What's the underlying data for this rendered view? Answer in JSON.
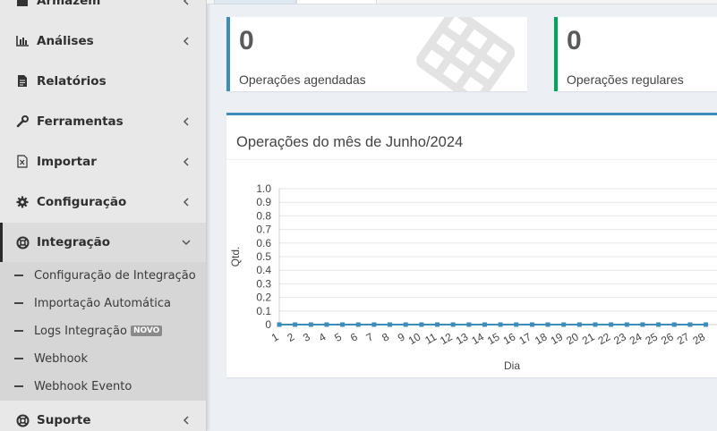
{
  "sidebar": {
    "items": [
      {
        "label": "Armazém",
        "icon": "warehouse-icon",
        "has_chevron": true
      },
      {
        "label": "Análises",
        "icon": "bar-chart-icon",
        "has_chevron": true
      },
      {
        "label": "Relatórios",
        "icon": "document-icon",
        "has_chevron": false
      },
      {
        "label": "Ferramentas",
        "icon": "wrench-icon",
        "has_chevron": true
      },
      {
        "label": "Importar",
        "icon": "import-file-icon",
        "has_chevron": true
      },
      {
        "label": "Configuração",
        "icon": "gear-icon",
        "has_chevron": true
      },
      {
        "label": "Integração",
        "icon": "lifebuoy-icon",
        "has_chevron": true,
        "expanded": true
      },
      {
        "label": "Suporte",
        "icon": "lifebuoy-icon",
        "has_chevron": true
      }
    ],
    "submenu": [
      {
        "label": "Configuração de Integração"
      },
      {
        "label": "Importação Automática"
      },
      {
        "label": "Logs Integração",
        "badge": "NOVO"
      },
      {
        "label": "Webhook"
      },
      {
        "label": "Webhook Evento"
      }
    ]
  },
  "stats": [
    {
      "value": "0",
      "caption": "Operações agendadas",
      "color": "#3c8dbc"
    },
    {
      "value": "0",
      "caption": "Operações regulares",
      "color": "#00a65a"
    }
  ],
  "panel": {
    "title": "Operações do mês de Junho/2024",
    "accent": "#3c8dbc"
  },
  "chart_data": {
    "type": "line",
    "title": "Operações do mês de Junho/2024",
    "xlabel": "Dia",
    "ylabel": "Qtd.",
    "x": [
      1,
      2,
      3,
      4,
      5,
      6,
      7,
      8,
      9,
      10,
      11,
      12,
      13,
      14,
      15,
      16,
      17,
      18,
      19,
      20,
      21,
      22,
      23,
      24,
      25,
      26,
      27,
      28
    ],
    "series": [
      {
        "values": [
          0,
          0,
          0,
          0,
          0,
          0,
          0,
          0,
          0,
          0,
          0,
          0,
          0,
          0,
          0,
          0,
          0,
          0,
          0,
          0,
          0,
          0,
          0,
          0,
          0,
          0,
          0,
          0
        ],
        "color": "#3c8dbc"
      }
    ],
    "ylim": [
      0,
      1.0
    ],
    "yticks": [
      "0",
      "0.1",
      "0.2",
      "0.3",
      "0.4",
      "0.5",
      "0.6",
      "0.7",
      "0.8",
      "0.9",
      "1.0"
    ],
    "grid": true
  }
}
